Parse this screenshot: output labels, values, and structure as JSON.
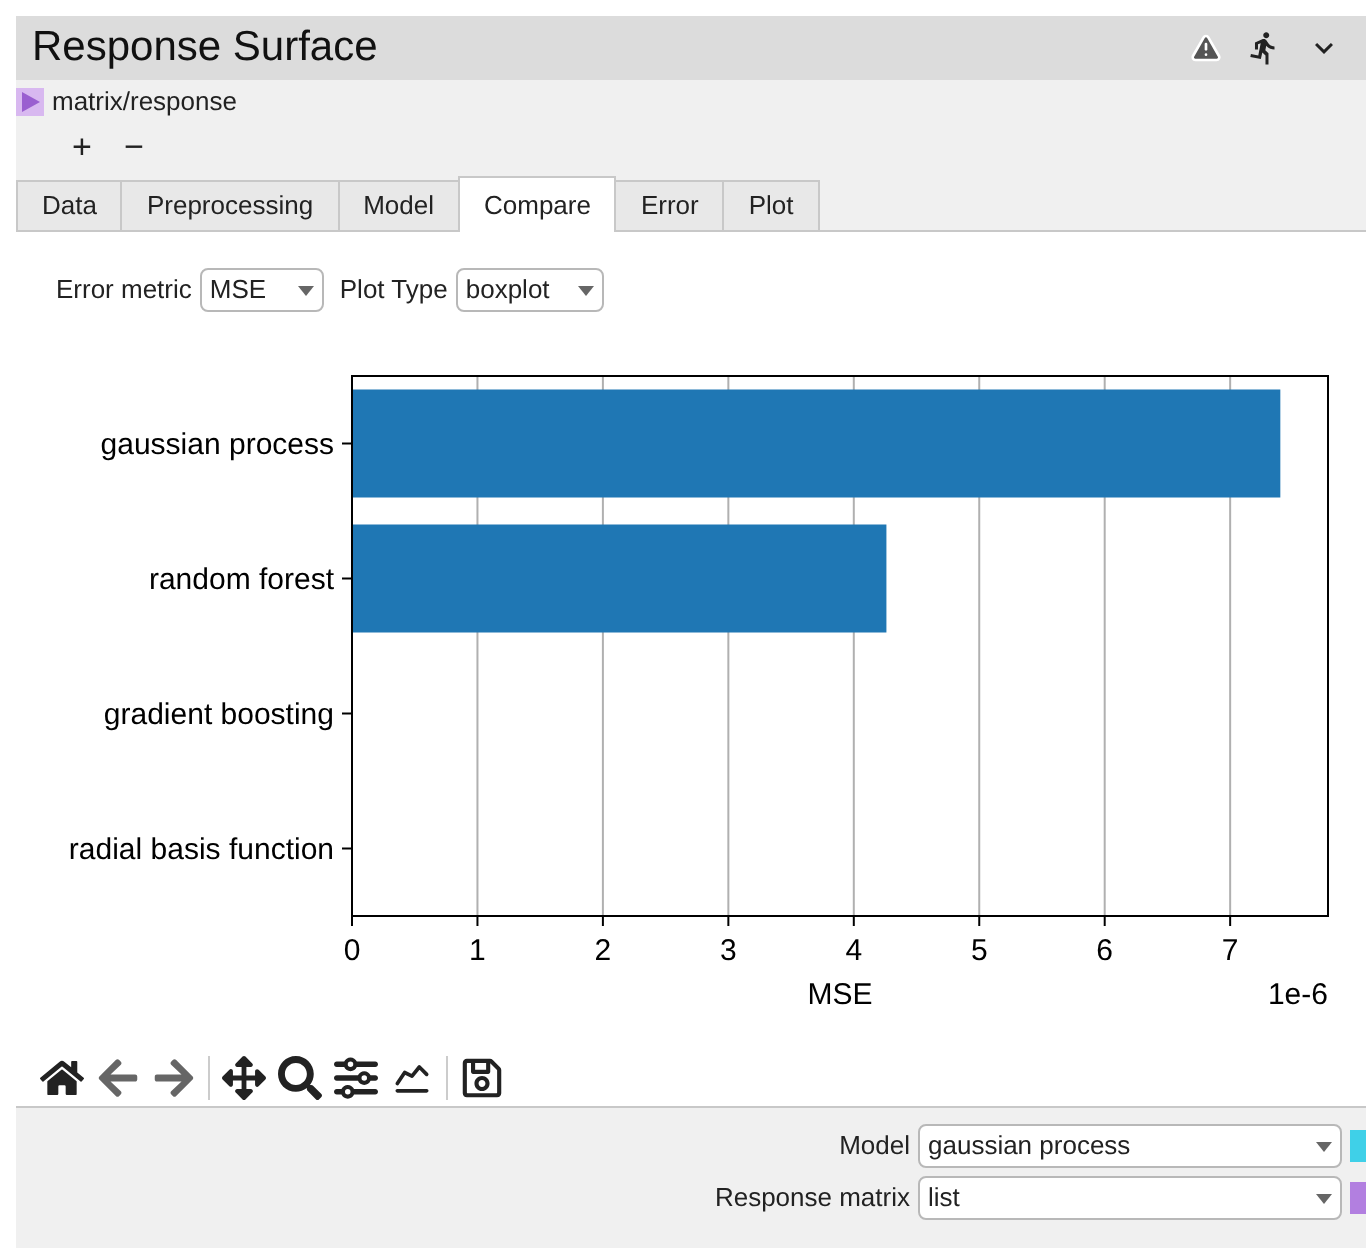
{
  "window": {
    "title": "Response Surface"
  },
  "input_port": {
    "label": "matrix/response"
  },
  "zoom_buttons": [
    "+",
    "−"
  ],
  "tabs": [
    {
      "label": "Data",
      "selected": false
    },
    {
      "label": "Preprocessing",
      "selected": false
    },
    {
      "label": "Model",
      "selected": false
    },
    {
      "label": "Compare",
      "selected": true
    },
    {
      "label": "Error",
      "selected": false
    },
    {
      "label": "Plot",
      "selected": false
    }
  ],
  "controls": [
    {
      "label": "Error metric",
      "value": "MSE"
    },
    {
      "label": "Plot Type",
      "value": "boxplot"
    }
  ],
  "chart_data": {
    "type": "bar",
    "orientation": "horizontal",
    "xlabel": "MSE",
    "categories": [
      "gaussian process",
      "random forest",
      "gradient boosting",
      "radial basis function"
    ],
    "series": [
      {
        "color": "#1f77b4",
        "values": [
          7.4,
          4.26,
          0,
          0
        ]
      }
    ],
    "grid": true,
    "xlim": [
      0,
      7.78
    ],
    "xticks": [
      0,
      1,
      2,
      3,
      4,
      5,
      6,
      7
    ],
    "annotations": [
      "1e-6"
    ]
  },
  "toolbar": [
    {
      "kind": "home"
    },
    {
      "kind": "back"
    },
    {
      "kind": "forward"
    },
    {
      "kind": "pan"
    },
    {
      "kind": "zoom"
    },
    {
      "kind": "configure"
    },
    {
      "kind": "axes"
    },
    {
      "kind": "save"
    }
  ],
  "outputs": [
    {
      "label": "Model",
      "value": "gaussian process",
      "color": "#3fd0e8"
    },
    {
      "label": "Response matrix",
      "value": "list",
      "color": "#b27fe0"
    }
  ]
}
